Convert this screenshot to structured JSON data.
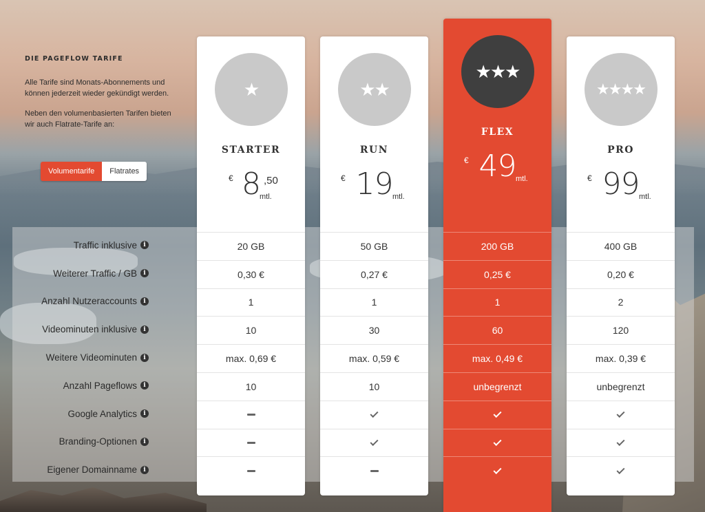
{
  "intro": {
    "title": "DIE PAGEFLOW TARIFE",
    "text1": "Alle Tarife sind Monats-Abonnements und können jederzeit wieder gekündigt werden.",
    "text2": "Neben den volumenbasierten Tarifen bieten wir auch Flatrate-Tarife an:"
  },
  "toggle": {
    "options": [
      "Volumentarife",
      "Flatrates"
    ],
    "active": "Volumentarife"
  },
  "features": [
    "Traffic inklusive",
    "Weiterer Traffic / GB",
    "Anzahl Nutzeraccounts",
    "Videominuten inklusive",
    "Weitere Videominuten",
    "Anzahl Pageflows",
    "Google Analytics",
    "Branding-Optionen",
    "Eigener Domainname"
  ],
  "info_icon_glyph": "i",
  "colors": {
    "accent": "#e34a31",
    "badge_default": "#c9c9c9",
    "badge_featured": "#3f3f3f"
  },
  "plans": [
    {
      "name": "STARTER",
      "stars": "★",
      "currency": "€",
      "amount": "8",
      "cents": ",50",
      "unit": "mtl.",
      "featured": false,
      "values": [
        "20 GB",
        "0,30 €",
        "1",
        "10",
        "max. 0,69 €",
        "10",
        "dash",
        "dash",
        "dash"
      ]
    },
    {
      "name": "RUN",
      "stars": "★★",
      "currency": "€",
      "amount": "19",
      "cents": "",
      "unit": "mtl.",
      "featured": false,
      "values": [
        "50 GB",
        "0,27 €",
        "1",
        "30",
        "max. 0,59 €",
        "10",
        "check",
        "check",
        "dash"
      ]
    },
    {
      "name": "FLEX",
      "stars": "★★★",
      "currency": "€",
      "amount": "49",
      "cents": "",
      "unit": "mtl.",
      "featured": true,
      "values": [
        "200 GB",
        "0,25 €",
        "1",
        "60",
        "max. 0,49 €",
        "unbegrenzt",
        "check",
        "check",
        "check"
      ]
    },
    {
      "name": "PRO",
      "stars": "★★★★",
      "currency": "€",
      "amount": "99",
      "cents": "",
      "unit": "mtl.",
      "featured": false,
      "values": [
        "400 GB",
        "0,20 €",
        "2",
        "120",
        "max. 0,39 €",
        "unbegrenzt",
        "check",
        "check",
        "check"
      ]
    }
  ]
}
